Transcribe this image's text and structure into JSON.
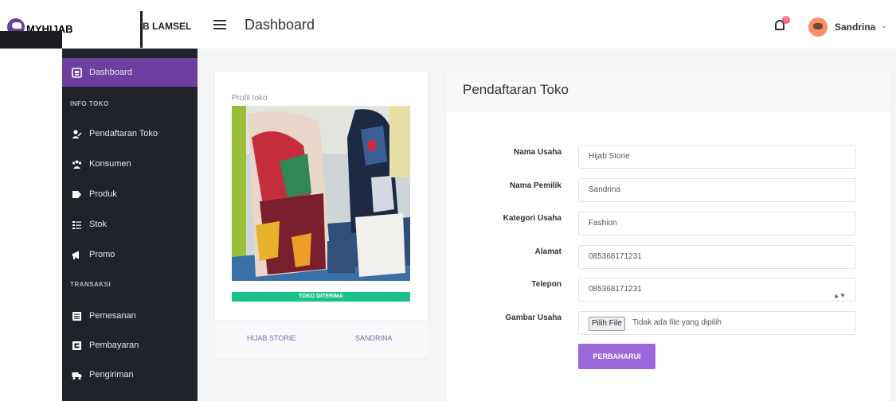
{
  "brand": {
    "name": "MYHIJAB",
    "sub": "B LAMSEL"
  },
  "header": {
    "title": "Dashboard",
    "notification_count": "0",
    "user_name": "Sandrina",
    "caret": "⌄"
  },
  "sidebar": {
    "dashboard": "Dashboard",
    "section_info": "INFO TOKO",
    "pendaftaran": "Pendaftaran Toko",
    "konsumen": "Konsumen",
    "produk": "Produk",
    "stok": "Stok",
    "promo": "Promo",
    "section_transaksi": "TRANSAKSI",
    "pemesanan": "Pemesanan",
    "pembayaran": "Pembayaran",
    "pengiriman": "Pengiriman"
  },
  "profile": {
    "caption": "Profil toko",
    "status": "TOKO DITERIMA",
    "shop_name": "HIJAB STORIE",
    "owner_name": "SANDRINA"
  },
  "form": {
    "title": "Pendaftaran Toko",
    "nama_usaha_label": "Nama Usaha",
    "nama_usaha_value": "Hijab Storie",
    "nama_pemilik_label": "Nama Pemilik",
    "nama_pemilik_value": "Sandrina",
    "kategori_label": "Kategori Usaha",
    "kategori_value": "Fashion",
    "alamat_label": "Alamat",
    "alamat_value": "085368171231",
    "telepon_label": "Telepon",
    "telepon_value": "085368171231",
    "gambar_label": "Gambar Usaha",
    "file_button": "Pilih File",
    "file_status": "Tidak ada file yang dipilih",
    "submit": "PERBAHARUI"
  }
}
